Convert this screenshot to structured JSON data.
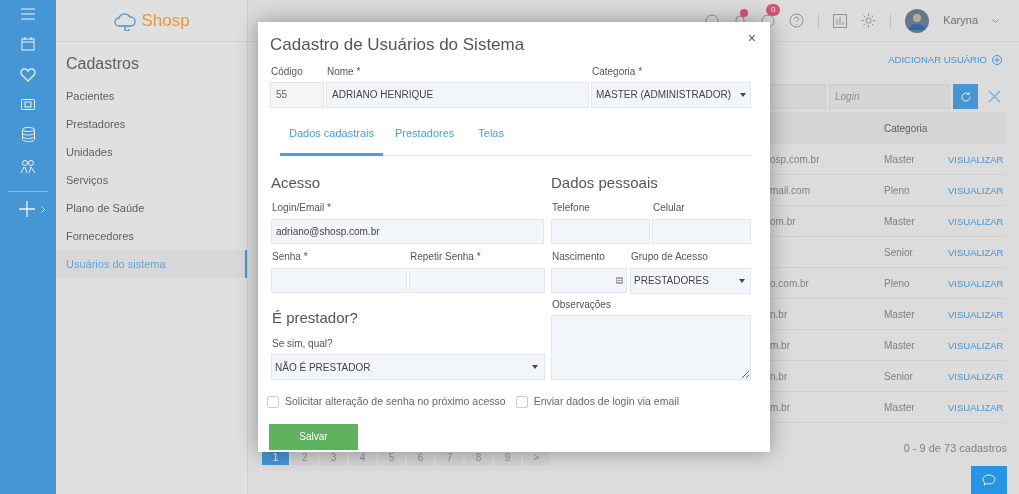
{
  "logo": {
    "text": "Shosp"
  },
  "sidebar": {
    "title": "Cadastros",
    "items": [
      {
        "label": "Pacientes",
        "selected": false
      },
      {
        "label": "Prestadores",
        "selected": false
      },
      {
        "label": "Unidades",
        "selected": false
      },
      {
        "label": "Serviços",
        "selected": false
      },
      {
        "label": "Plano de Saúde",
        "selected": false
      },
      {
        "label": "Fornecedores",
        "selected": false
      },
      {
        "label": "Usuários do sistema",
        "selected": true
      }
    ]
  },
  "header": {
    "notification_count": "0",
    "user_name": "Karyna"
  },
  "main": {
    "add_button": "ADICIONAR USUÁRIO",
    "login_filter": {
      "placeholder": "Login"
    },
    "table": {
      "columns": [
        "Categoria"
      ],
      "rows": [
        {
          "email": "osp.com.br",
          "category": "Master",
          "action": "VISUALIZAR"
        },
        {
          "email": "mail.com",
          "category": "Pleno",
          "action": "VISUALIZAR"
        },
        {
          "email": "om.br",
          "category": "Master",
          "action": "VISUALIZAR"
        },
        {
          "email": "",
          "category": "Senior",
          "action": "VISUALIZAR"
        },
        {
          "email": "o.com.br",
          "category": "Pleno",
          "action": "VISUALIZAR"
        },
        {
          "email": "n.br",
          "category": "Master",
          "action": "VISUALIZAR"
        },
        {
          "email": "m.br",
          "category": "Master",
          "action": "VISUALIZAR"
        },
        {
          "email": "n.br",
          "category": "Senior",
          "action": "VISUALIZAR"
        },
        {
          "email": "m.br",
          "category": "Master",
          "action": "VISUALIZAR"
        }
      ]
    },
    "pagination": {
      "pages": [
        {
          "label": "1",
          "selected": true
        },
        {
          "label": "2",
          "selected": false
        },
        {
          "label": "3",
          "selected": false
        },
        {
          "label": "4",
          "selected": false
        },
        {
          "label": "5",
          "selected": false
        },
        {
          "label": "6",
          "selected": false
        },
        {
          "label": "7",
          "selected": false
        },
        {
          "label": "8",
          "selected": false
        },
        {
          "label": "9",
          "selected": false
        }
      ],
      "next": ">"
    },
    "record_count": "0 - 9 de 73 cadastros"
  },
  "modal": {
    "title": "Cadastro de Usuários do Sistema",
    "close": "×",
    "codigo": {
      "label": "Código",
      "value": "55"
    },
    "nome": {
      "label": "Nome *",
      "value": "ADRIANO HENRIQUE"
    },
    "categoria": {
      "label": "Categoria *",
      "value": "MASTER (ADMINISTRADOR)"
    },
    "tabs": [
      {
        "label": "Dados cadastrais",
        "selected": true
      },
      {
        "label": "Prestadores",
        "selected": false
      },
      {
        "label": "Telas",
        "selected": false
      }
    ],
    "acesso": {
      "heading": "Acesso",
      "login": {
        "label": "Login/Email *",
        "value": "adriano@shosp.com.br"
      },
      "senha": {
        "label": "Senha *"
      },
      "repetir_senha": {
        "label": "Repetir Senha *"
      }
    },
    "prestador": {
      "heading": "É prestador?",
      "label": "Se sim, qual?",
      "value": "NÃO É PRESTADOR"
    },
    "dados_pessoais": {
      "heading": "Dados pessoais",
      "telefone": {
        "label": "Telefone"
      },
      "celular": {
        "label": "Celular"
      },
      "nascimento": {
        "label": "Nascimento"
      },
      "grupo": {
        "label": "Grupo de Acesso",
        "value": "PRESTADORES"
      },
      "observacoes": {
        "label": "Observações"
      }
    },
    "checkboxes": [
      {
        "label": "Solicitar alteração de senha no próximo acesso",
        "checked": false
      },
      {
        "label": "Enviar dados de login via email",
        "checked": false
      }
    ],
    "save_button": "Salvar"
  }
}
